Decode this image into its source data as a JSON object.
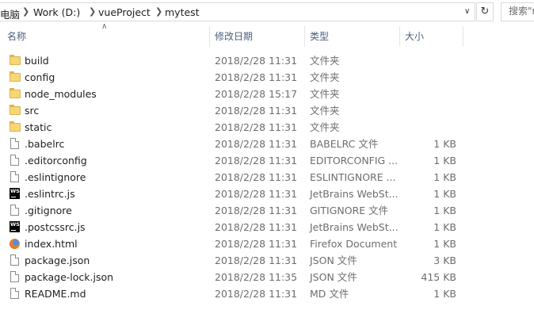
{
  "address": {
    "crumbs": [
      "电脑",
      "Work (D:)",
      "vueProject",
      "mytest"
    ],
    "search_placeholder": "搜索\"m"
  },
  "header": {
    "name": "名称",
    "date": "修改日期",
    "type": "类型",
    "size": "大小"
  },
  "files": [
    {
      "name": "build",
      "date": "2018/2/28 11:31",
      "type": "文件夹",
      "size": "",
      "icon": "folder-icon"
    },
    {
      "name": "config",
      "date": "2018/2/28 11:31",
      "type": "文件夹",
      "size": "",
      "icon": "folder-icon"
    },
    {
      "name": "node_modules",
      "date": "2018/2/28 15:17",
      "type": "文件夹",
      "size": "",
      "icon": "folder-icon"
    },
    {
      "name": "src",
      "date": "2018/2/28 11:31",
      "type": "文件夹",
      "size": "",
      "icon": "folder-icon"
    },
    {
      "name": "static",
      "date": "2018/2/28 11:31",
      "type": "文件夹",
      "size": "",
      "icon": "folder-icon"
    },
    {
      "name": ".babelrc",
      "date": "2018/2/28 11:31",
      "type": "BABELRC 文件",
      "size": "1 KB",
      "icon": "file-icon"
    },
    {
      "name": ".editorconfig",
      "date": "2018/2/28 11:31",
      "type": "EDITORCONFIG ...",
      "size": "1 KB",
      "icon": "file-icon"
    },
    {
      "name": ".eslintignore",
      "date": "2018/2/28 11:31",
      "type": "ESLINTIGNORE ...",
      "size": "1 KB",
      "icon": "file-icon"
    },
    {
      "name": ".eslintrc.js",
      "date": "2018/2/28 11:31",
      "type": "JetBrains WebSt...",
      "size": "1 KB",
      "icon": "webstorm-icon"
    },
    {
      "name": ".gitignore",
      "date": "2018/2/28 11:31",
      "type": "GITIGNORE 文件",
      "size": "1 KB",
      "icon": "file-icon"
    },
    {
      "name": ".postcssrc.js",
      "date": "2018/2/28 11:31",
      "type": "JetBrains WebSt...",
      "size": "1 KB",
      "icon": "webstorm-icon"
    },
    {
      "name": "index.html",
      "date": "2018/2/28 11:31",
      "type": "Firefox Document",
      "size": "1 KB",
      "icon": "firefox-icon"
    },
    {
      "name": "package.json",
      "date": "2018/2/28 11:31",
      "type": "JSON 文件",
      "size": "3 KB",
      "icon": "file-icon"
    },
    {
      "name": "package-lock.json",
      "date": "2018/2/28 11:35",
      "type": "JSON 文件",
      "size": "415 KB",
      "icon": "file-icon"
    },
    {
      "name": "README.md",
      "date": "2018/2/28 11:31",
      "type": "MD 文件",
      "size": "1 KB",
      "icon": "file-icon"
    }
  ]
}
